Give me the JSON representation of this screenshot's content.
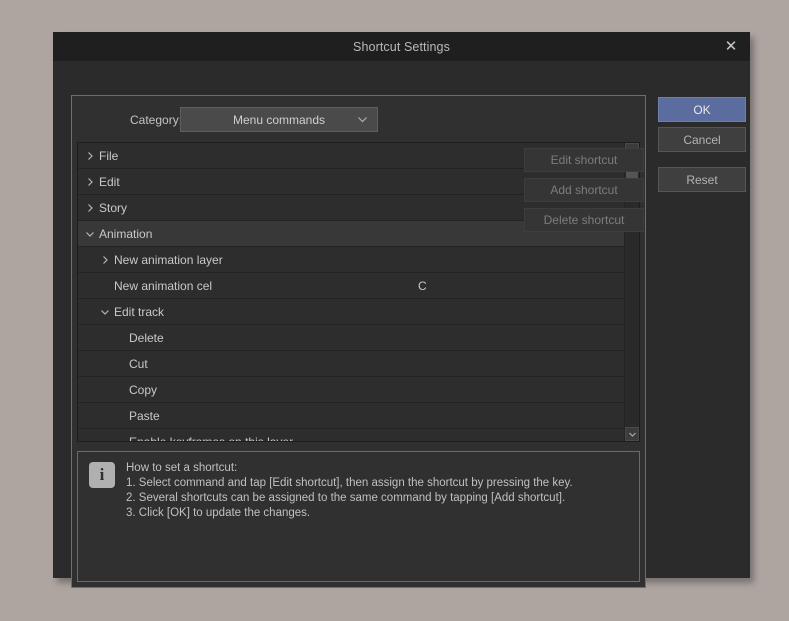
{
  "window": {
    "title": "Shortcut Settings",
    "close_icon": "close-icon"
  },
  "category": {
    "label": "Category:",
    "selected": "Menu commands",
    "chevron_icon": "chevron-down-icon"
  },
  "tree": {
    "rows": [
      {
        "label": "File",
        "level": 0,
        "arrow": "collapsed",
        "shortcut": "",
        "selected": false
      },
      {
        "label": "Edit",
        "level": 0,
        "arrow": "collapsed",
        "shortcut": "",
        "selected": false
      },
      {
        "label": "Story",
        "level": 0,
        "arrow": "collapsed",
        "shortcut": "",
        "selected": false
      },
      {
        "label": "Animation",
        "level": 0,
        "arrow": "expanded",
        "shortcut": "",
        "selected": true
      },
      {
        "label": "New animation layer",
        "level": 1,
        "arrow": "collapsed",
        "shortcut": "",
        "selected": false
      },
      {
        "label": "New animation cel",
        "level": 1,
        "arrow": "none",
        "shortcut": "C",
        "selected": false
      },
      {
        "label": "Edit track",
        "level": 1,
        "arrow": "expanded",
        "shortcut": "",
        "selected": false
      },
      {
        "label": "Delete",
        "level": 2,
        "arrow": "none",
        "shortcut": "",
        "selected": false
      },
      {
        "label": "Cut",
        "level": 2,
        "arrow": "none",
        "shortcut": "",
        "selected": false
      },
      {
        "label": "Copy",
        "level": 2,
        "arrow": "none",
        "shortcut": "",
        "selected": false
      },
      {
        "label": "Paste",
        "level": 2,
        "arrow": "none",
        "shortcut": "",
        "selected": false
      },
      {
        "label": "Enable keyframes on this layer",
        "level": 2,
        "arrow": "none",
        "shortcut": "",
        "selected": false
      }
    ],
    "scrollbar": {
      "up_icon": "chevron-up-icon",
      "down_icon": "chevron-down-icon"
    }
  },
  "actions": {
    "edit_shortcut": "Edit shortcut",
    "add_shortcut": "Add shortcut",
    "delete_shortcut": "Delete shortcut"
  },
  "info": {
    "icon": "info-icon",
    "lines": [
      "How to set a shortcut:",
      "1. Select command and tap [Edit shortcut], then assign the shortcut by pressing the key.",
      "2. Several shortcuts can be assigned to the same command by tapping [Add shortcut].",
      "3. Click [OK] to update the changes."
    ]
  },
  "buttons": {
    "ok": "OK",
    "cancel": "Cancel",
    "reset": "Reset"
  },
  "colors": {
    "desktop_background": "#aea5a1",
    "dialog_background": "#2b2b2b",
    "titlebar": "#1f1f1f",
    "ok_accent": "#5b6d9e",
    "text": "#c9c9c9",
    "disabled_text": "#7d7d7d"
  }
}
